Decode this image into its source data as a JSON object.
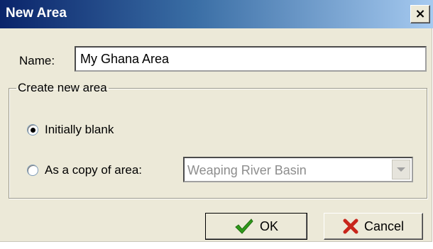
{
  "window": {
    "title": "New Area",
    "close_glyph": "×"
  },
  "name": {
    "label": "Name:",
    "value": "My Ghana Area"
  },
  "group": {
    "legend": "Create new area",
    "options": [
      {
        "label": "Initially blank",
        "selected": true
      },
      {
        "label": "As a copy of area:",
        "selected": false
      }
    ],
    "copy_source": {
      "value": "Weaping River Basin",
      "enabled": false
    }
  },
  "buttons": {
    "ok_label": "OK",
    "cancel_label": "Cancel"
  },
  "icons": {
    "ok": "checkmark-icon",
    "cancel": "x-icon"
  },
  "colors": {
    "titlebar_start": "#0a246a",
    "titlebar_end": "#a6caf0",
    "ok_check": "#2f9a1b",
    "cancel_x": "#c8251b"
  }
}
